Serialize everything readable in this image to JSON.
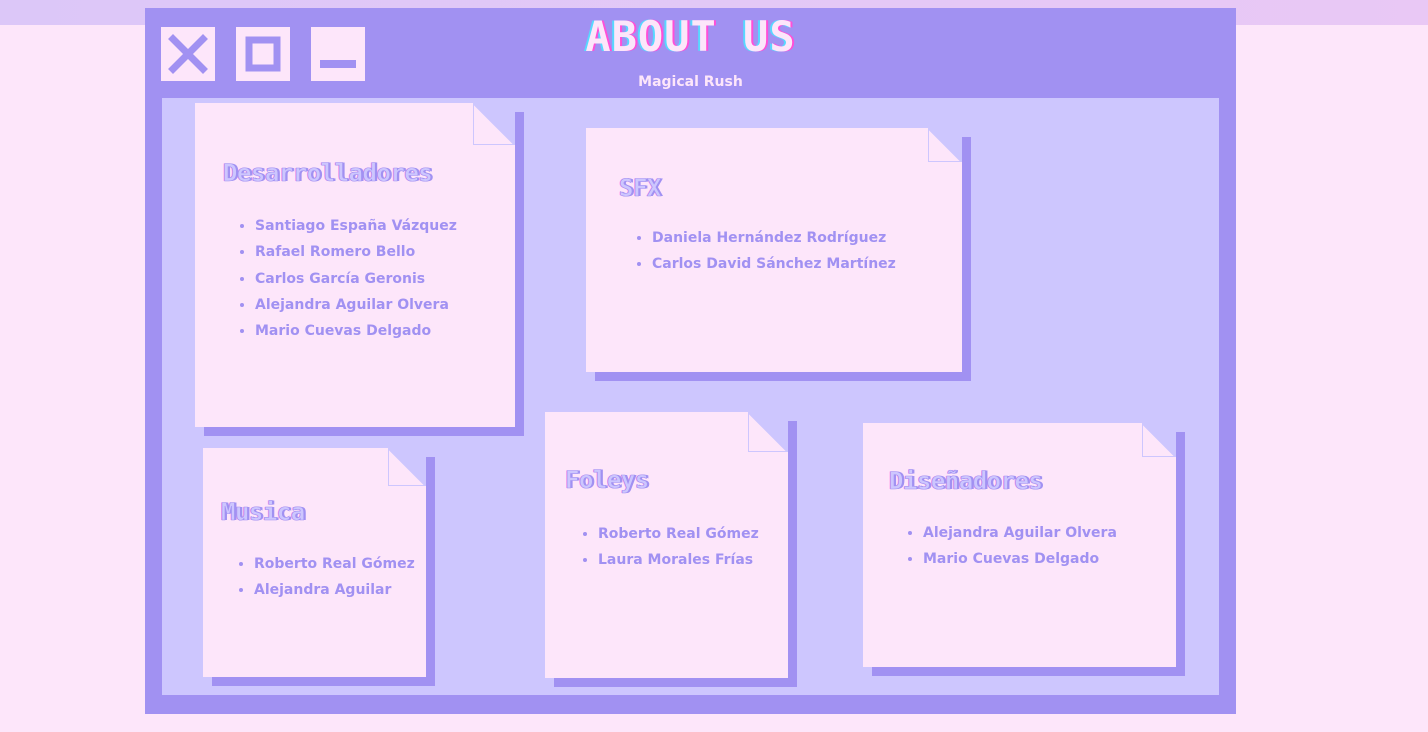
{
  "window": {
    "title": "ABOUT US",
    "subtitle": "Magical Rush"
  },
  "controls": {
    "close_icon": "close-icon",
    "maximize_icon": "maximize-icon",
    "minimize_icon": "minimize-icon"
  },
  "colors": {
    "background": "#fde6fa",
    "window": "#a191f2",
    "panel": "#cdc6fe",
    "note": "#fde6fa",
    "text": "#a191f2"
  },
  "notes": {
    "desarrolladores": {
      "heading": "Desarrolladores",
      "members": [
        "Santiago España Vázquez",
        "Rafael Romero Bello",
        "Carlos García Geronis",
        "Alejandra Aguilar Olvera",
        "Mario Cuevas Delgado"
      ]
    },
    "sfx": {
      "heading": "SFX",
      "members": [
        "Daniela Hernández Rodríguez",
        "Carlos David Sánchez Martínez"
      ]
    },
    "musica": {
      "heading": "Musica",
      "members": [
        "Roberto Real Gómez",
        "Alejandra Aguilar"
      ]
    },
    "foleys": {
      "heading": "Foleys",
      "members": [
        "Roberto Real Gómez",
        "Laura Morales Frías"
      ]
    },
    "disenadores": {
      "heading": "Diseñadores",
      "members": [
        "Alejandra Aguilar Olvera",
        "Mario Cuevas Delgado"
      ]
    }
  }
}
